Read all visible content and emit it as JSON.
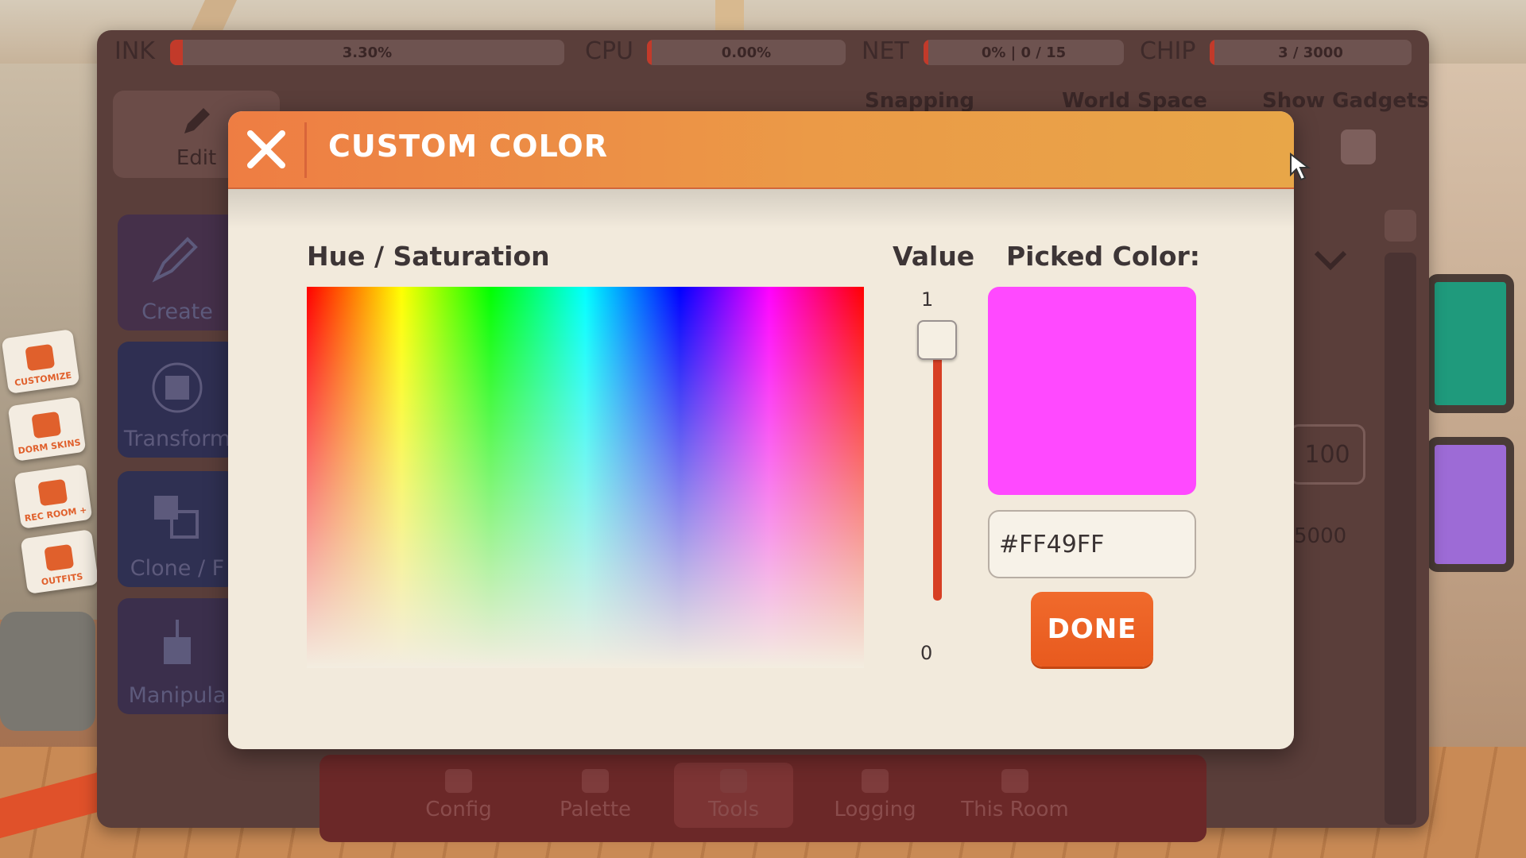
{
  "stats": [
    {
      "label": "INK",
      "value": "3.30%",
      "fill": 0.033
    },
    {
      "label": "CPU",
      "value": "0.00%",
      "fill": 0.0
    },
    {
      "label": "NET",
      "value": "0% | 0 / 15",
      "fill": 0.0
    },
    {
      "label": "CHIP",
      "value": "3 / 3000",
      "fill": 0.001
    }
  ],
  "toolbar": {
    "edit_label": "Edit",
    "snapping_label": "Snapping",
    "world_space_label": "World Space",
    "show_gadgets_label": "Show Gadgets"
  },
  "tools": [
    {
      "label": "Create"
    },
    {
      "label": "Transform"
    },
    {
      "label": "Clone / F"
    },
    {
      "label": "Manipula"
    }
  ],
  "right_panel": {
    "value_a": "100",
    "value_b": "5000"
  },
  "bottom_tabs": [
    {
      "label": "Config"
    },
    {
      "label": "Palette"
    },
    {
      "label": "Tools"
    },
    {
      "label": "Logging"
    },
    {
      "label": "This Room"
    }
  ],
  "side_menu": [
    {
      "label": "CUSTOMIZE"
    },
    {
      "label": "DORM SKINS"
    },
    {
      "label": "REC ROOM +"
    },
    {
      "label": "OUTFITS"
    }
  ],
  "dialog": {
    "title": "CUSTOM COLOR",
    "hue_sat_label": "Hue / Saturation",
    "value_label": "Value",
    "value_max": "1",
    "value_min": "0",
    "value_level": 1.0,
    "picked_label": "Picked Color:",
    "hex_value": "#FF49FF",
    "done_label": "DONE"
  },
  "colors": {
    "picked": "#FF49FF",
    "accent": "#EE7D43",
    "done": "#E85A1E",
    "slider": "#D73F24"
  }
}
